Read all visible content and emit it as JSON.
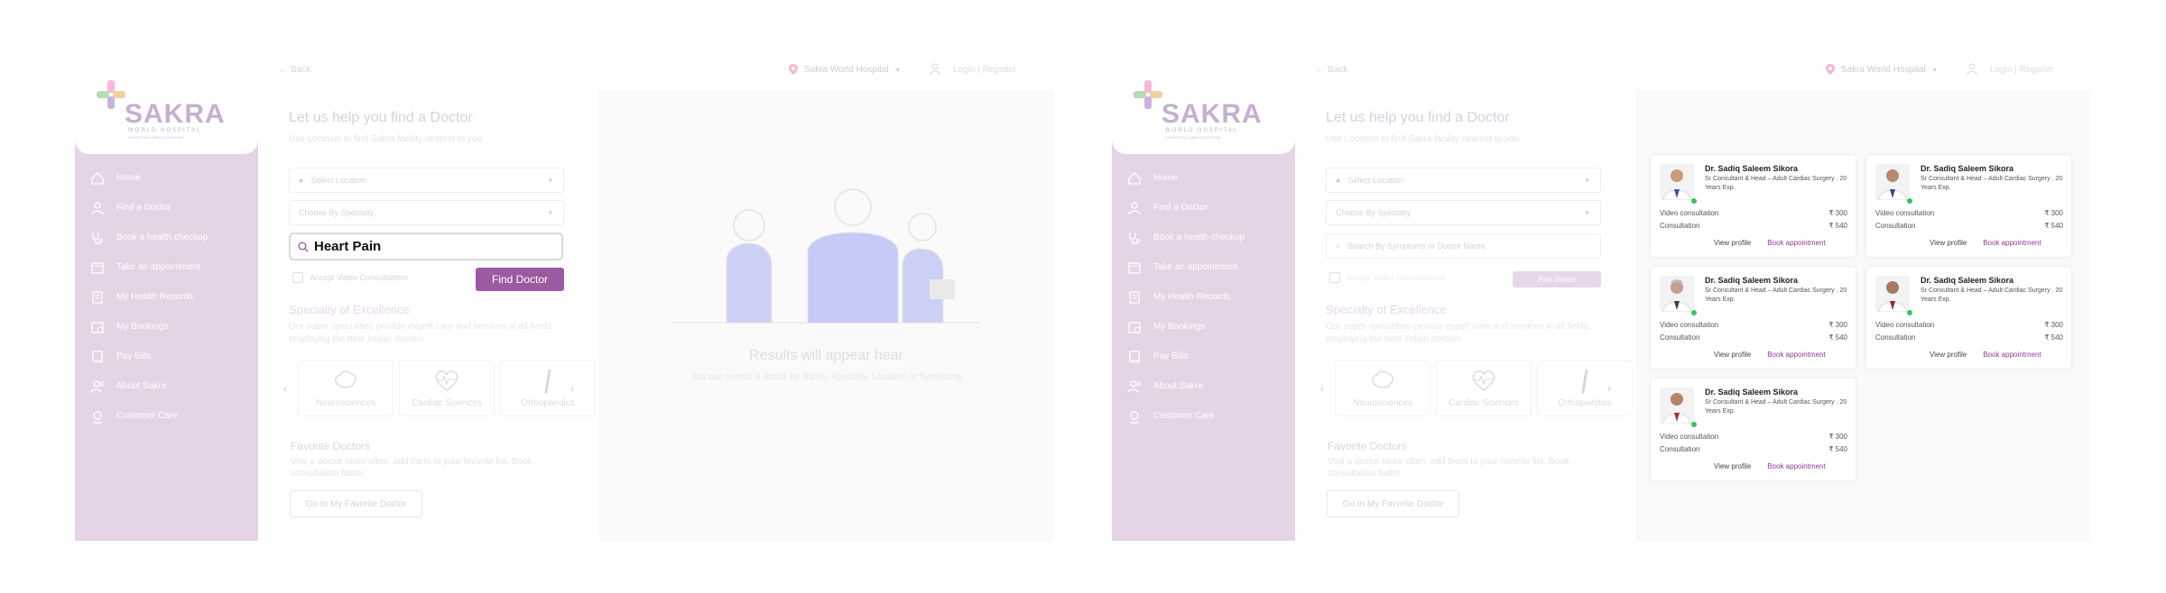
{
  "brand": {
    "name": "SAKRA",
    "subtitle": "WORLD HOSPITAL",
    "tagline": "A HOSPITAL CARE ECOSYSTEM",
    "accent": "#9b5ba0",
    "sidebar_bg": "#e5d4e5"
  },
  "sidebar": {
    "items": [
      {
        "label": "Home",
        "icon": "home-icon"
      },
      {
        "label": "Find a Doctor",
        "icon": "doctor-icon"
      },
      {
        "label": "Book a health checkup",
        "icon": "stethoscope-icon"
      },
      {
        "label": "Take an appointment",
        "icon": "calendar-icon"
      },
      {
        "label": "My Health Records",
        "icon": "records-icon"
      },
      {
        "label": "My Bookings",
        "icon": "bookings-icon"
      },
      {
        "label": "Pay Bills",
        "icon": "bill-icon"
      },
      {
        "label": "About Sakra",
        "icon": "about-icon"
      },
      {
        "label": "Customer Care",
        "icon": "support-icon"
      }
    ]
  },
  "topbar": {
    "back": "Back",
    "hospital": "Sakra World Hospital",
    "login": "Login | Register"
  },
  "screen1": {
    "title": "Let us help you find a Doctor",
    "subtitle": "Use Location to find Sakra facility nearest to you",
    "location_placeholder": "Select Location",
    "specialty_placeholder": "Choose By Specialty",
    "search_value": "Heart Pain",
    "video_checkbox": "Accept Video Consultations",
    "find_button": "Find Doctor",
    "specialty_title": "Specialty of Excellence",
    "specialty_desc": "Our super specialties provide expert care and services in all fields, employing the best Indian doctors.",
    "specialties": [
      "Neurosciences",
      "Cardiac Sciences",
      "Orthopaedics"
    ],
    "fav_title": "Favorite Doctors",
    "fav_desc": "Visit a doctor more often, add them to your favorite list. Book consultation faster.",
    "fav_button": "Go to My Favorite Doctor",
    "results_title": "Results will appear hear",
    "results_sub": "You can search a doctor by Name, Specialty, Location or Symptoms"
  },
  "screen2": {
    "title": "Let us help you find a Doctor",
    "subtitle": "Use Location to find Sakra facility nearest to you.",
    "location_placeholder": "Select Location",
    "specialty_placeholder": "Choose By Specialty",
    "search_placeholder": "Search By Symptoms or Doctor Name",
    "video_checkbox": "Accept Video Consultations",
    "find_button": "Find Doctor",
    "specialty_title": "Specialty of Excellence",
    "specialty_desc": "Our super specialties provide expert care and services in all fields, employing the best Indian doctors.",
    "specialties": [
      "Neurosciences",
      "Cardiac Sciences",
      "Orthopaedics"
    ],
    "fav_title": "Favorite Doctors",
    "fav_desc": "Visit a doctor more often, add them to your favorite list. Book consultation faster.",
    "fav_button": "Go to My Favorite Doctor",
    "doctors": [
      {
        "name": "Dr. Sadiq Saleem Sikora",
        "role": "Sr Consultant & Head – Adult Cardiac Surgery . 20 Years Exp.",
        "video_label": "Video consultation",
        "video_fee": "₹ 300",
        "consult_label": "Consultation",
        "consult_fee": "₹ 540",
        "view": "View profile",
        "book": "Book appointment"
      },
      {
        "name": "Dr. Sadiq Saleem Sikora",
        "role": "Sr Consultant & Head – Adult Cardiac Surgery . 20 Years Exp.",
        "video_label": "Video consultation",
        "video_fee": "₹ 300",
        "consult_label": "Consultation",
        "consult_fee": "₹ 540",
        "view": "View profile",
        "book": "Book appointment"
      },
      {
        "name": "Dr. Sadiq Saleem Sikora",
        "role": "Sr Consultant & Head – Adult Cardiac Surgery . 20 Years Exp.",
        "video_label": "Video consultation",
        "video_fee": "₹ 300",
        "consult_label": "Consultation",
        "consult_fee": "₹ 540",
        "view": "View profile",
        "book": "Book appointment"
      },
      {
        "name": "Dr. Sadiq Saleem Sikora",
        "role": "Sr Consultant & Head – Adult Cardiac Surgery . 20 Years Exp.",
        "video_label": "Video consultation",
        "video_fee": "₹ 300",
        "consult_label": "Consultation",
        "consult_fee": "₹ 540",
        "view": "View profile",
        "book": "Book appointment"
      },
      {
        "name": "Dr. Sadiq Saleem Sikora",
        "role": "Sr Consultant & Head – Adult Cardiac Surgery . 20 Years Exp.",
        "video_label": "Video consultation",
        "video_fee": "₹ 300",
        "consult_label": "Consultation",
        "consult_fee": "₹ 540",
        "view": "View profile",
        "book": "Book appointment"
      }
    ]
  }
}
